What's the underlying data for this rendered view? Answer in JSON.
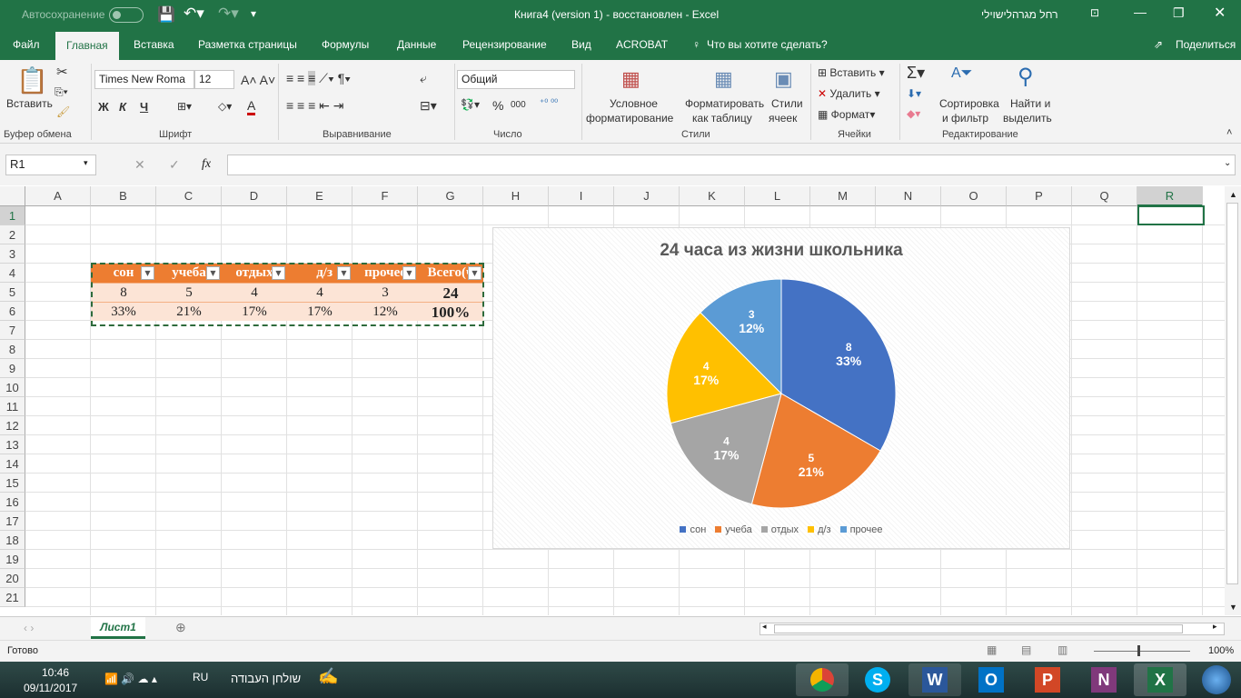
{
  "title": {
    "autosave": "Автосохранение",
    "doc": "Книга4 (version 1)  -  восстановлен  -  Excel",
    "user": "רחל מגרהלישוילי"
  },
  "tabs": [
    "Файл",
    "Главная",
    "Вставка",
    "Разметка страницы",
    "Формулы",
    "Данные",
    "Рецензирование",
    "Вид",
    "ACROBAT"
  ],
  "tell_me": "Что вы хотите сделать?",
  "share": "Поделиться",
  "ribbon": {
    "paste": "Вставить",
    "clipboard": "Буфер обмена",
    "font_name": "Times New Roma",
    "font_size": "12",
    "bold": "Ж",
    "italic": "К",
    "underline": "Ч",
    "font": "Шрифт",
    "alignment": "Выравнивание",
    "number_format": "Общий",
    "number": "Число",
    "percent": "%",
    "thousands": "000",
    "cond_format_1": "Условное",
    "cond_format_2": "форматирование",
    "format_table_1": "Форматировать",
    "format_table_2": "как таблицу",
    "cell_styles_1": "Стили",
    "cell_styles_2": "ячеек",
    "styles": "Стили",
    "insert": "Вставить",
    "delete": "Удалить",
    "format": "Формат",
    "cells": "Ячейки",
    "sort_1": "Сортировка",
    "sort_2": "и фильтр",
    "find_1": "Найти и",
    "find_2": "выделить",
    "editing": "Редактирование"
  },
  "formula_bar": {
    "name_box": "R1",
    "fx": "fx",
    "value": ""
  },
  "columns": [
    "A",
    "B",
    "C",
    "D",
    "E",
    "F",
    "G",
    "H",
    "I",
    "J",
    "K",
    "L",
    "M",
    "N",
    "O",
    "P",
    "Q",
    "R"
  ],
  "rows": [
    "1",
    "2",
    "3",
    "4",
    "5",
    "6",
    "7",
    "8",
    "9",
    "10",
    "11",
    "12",
    "13",
    "14",
    "15",
    "16",
    "17",
    "18",
    "19",
    "20",
    "21"
  ],
  "table": {
    "headers": [
      "сон",
      "учеба",
      "отдых",
      "д/з",
      "прочее",
      "Всего(ч"
    ],
    "values": [
      "8",
      "5",
      "4",
      "4",
      "3",
      "24"
    ],
    "percents": [
      "33%",
      "21%",
      "17%",
      "17%",
      "12%",
      "100%"
    ]
  },
  "chart_data": {
    "type": "pie",
    "title": "24 часа из жизни школьника",
    "categories": [
      "сон",
      "учеба",
      "отдых",
      "д/з",
      "прочее"
    ],
    "values": [
      8,
      5,
      4,
      4,
      3
    ],
    "labels": [
      "33%",
      "21%",
      "17%",
      "17%",
      "12%"
    ],
    "colors": [
      "#4472c4",
      "#ed7d31",
      "#a5a5a5",
      "#ffc000",
      "#5b9bd5"
    ],
    "legend": "bottom"
  },
  "sheet_tab": "Лист1",
  "status": "Готово",
  "zoom": "100%",
  "taskbar": {
    "time": "10:46",
    "date": "09/11/2017",
    "lang": "RU",
    "desktop": "שולחן העבודה"
  }
}
